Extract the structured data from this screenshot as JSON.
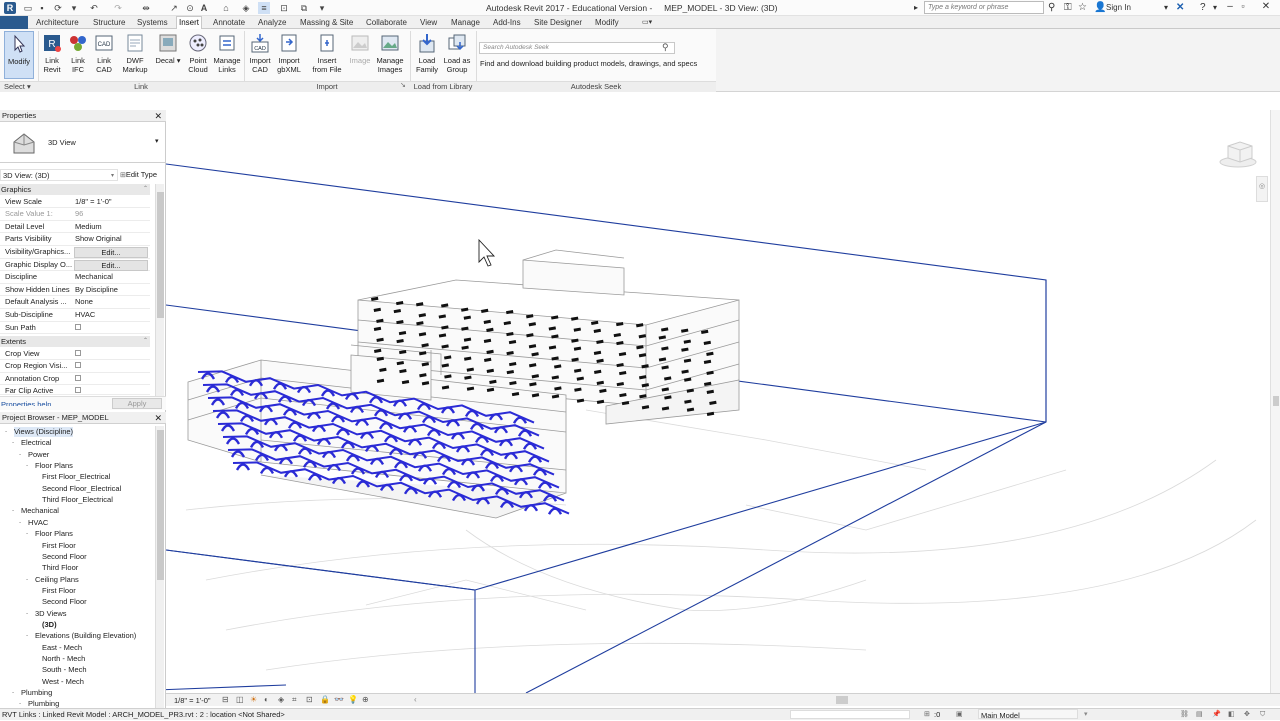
{
  "window": {
    "title": "Autodesk Revit 2017 - Educational Version -     MEP_MODEL - 3D View: (3D)",
    "search_placeholder": "Type a keyword or phrase",
    "sign_in": "Sign In"
  },
  "ribbon": {
    "tabs": [
      "Architecture",
      "Structure",
      "Systems",
      "Insert",
      "Annotate",
      "Analyze",
      "Massing & Site",
      "Collaborate",
      "View",
      "Manage",
      "Add-Ins",
      "Site Designer",
      "Modify"
    ],
    "active_tab": "Insert",
    "modify": {
      "label": "Modify"
    },
    "select_label": "Select",
    "link_panel": {
      "label": "Link",
      "buttons": [
        {
          "l1": "Link",
          "l2": "Revit"
        },
        {
          "l1": "Link",
          "l2": "IFC"
        },
        {
          "l1": "Link",
          "l2": "CAD"
        },
        {
          "l1": "DWF",
          "l2": "Markup"
        },
        {
          "l1": "Decal",
          "l2": ""
        },
        {
          "l1": "Point",
          "l2": "Cloud"
        },
        {
          "l1": "Manage",
          "l2": "Links"
        }
      ]
    },
    "import_panel": {
      "label": "Import",
      "buttons": [
        {
          "l1": "Import",
          "l2": "CAD"
        },
        {
          "l1": "Import",
          "l2": "gbXML"
        },
        {
          "l1": "Insert",
          "l2": "from File"
        },
        {
          "l1": "Image",
          "l2": ""
        },
        {
          "l1": "Manage",
          "l2": "Images"
        }
      ]
    },
    "library_panel": {
      "label": "Load from Library",
      "buttons": [
        {
          "l1": "Load",
          "l2": "Family"
        },
        {
          "l1": "Load as",
          "l2": "Group"
        }
      ]
    },
    "seek_panel": {
      "label": "Autodesk Seek",
      "placeholder": "Search Autodesk Seek",
      "description": "Find and download building product models, drawings, and specs"
    }
  },
  "properties": {
    "title": "Properties",
    "type_name": "3D View",
    "selector": "3D View: (3D)",
    "edit_type": "Edit Type",
    "categories": {
      "graphics": "Graphics",
      "extents": "Extents"
    },
    "rows": [
      {
        "k": "View Scale",
        "v": "1/8\" = 1'-0\""
      },
      {
        "k": "Scale Value    1:",
        "v": "96"
      },
      {
        "k": "Detail Level",
        "v": "Medium"
      },
      {
        "k": "Parts Visibility",
        "v": "Show Original"
      },
      {
        "k": "Visibility/Graphics...",
        "v": "Edit..."
      },
      {
        "k": "Graphic Display O...",
        "v": "Edit..."
      },
      {
        "k": "Discipline",
        "v": "Mechanical"
      },
      {
        "k": "Show Hidden Lines",
        "v": "By Discipline"
      },
      {
        "k": "Default Analysis ...",
        "v": "None"
      },
      {
        "k": "Sub-Discipline",
        "v": "HVAC"
      },
      {
        "k": "Sun Path",
        "v": ""
      }
    ],
    "extents_rows": [
      {
        "k": "Crop View"
      },
      {
        "k": "Crop Region Visi..."
      },
      {
        "k": "Annotation Crop"
      },
      {
        "k": "Far Clip Active"
      }
    ],
    "help_link": "Properties help",
    "apply": "Apply"
  },
  "browser": {
    "title": "Project Browser - MEP_MODEL",
    "nodes": [
      {
        "t": "Views (Discipline)",
        "d": 0,
        "tog": "-",
        "sel": true
      },
      {
        "t": "Electrical",
        "d": 1,
        "tog": "-"
      },
      {
        "t": "Power",
        "d": 2,
        "tog": "-"
      },
      {
        "t": "Floor Plans",
        "d": 3,
        "tog": "-"
      },
      {
        "t": "First Floor_Electrical",
        "d": 4
      },
      {
        "t": "Second Floor_Electrical",
        "d": 4
      },
      {
        "t": "Third Floor_Electrical",
        "d": 4
      },
      {
        "t": "Mechanical",
        "d": 1,
        "tog": "-"
      },
      {
        "t": "HVAC",
        "d": 2,
        "tog": "-"
      },
      {
        "t": "Floor Plans",
        "d": 3,
        "tog": "-"
      },
      {
        "t": "First Floor",
        "d": 4
      },
      {
        "t": "Second Floor",
        "d": 4
      },
      {
        "t": "Third Floor",
        "d": 4
      },
      {
        "t": "Ceiling Plans",
        "d": 3,
        "tog": "-"
      },
      {
        "t": "First Floor",
        "d": 4
      },
      {
        "t": "Second Floor",
        "d": 4
      },
      {
        "t": "3D Views",
        "d": 3,
        "tog": "-"
      },
      {
        "t": "(3D)",
        "d": 4,
        "bold": true
      },
      {
        "t": "Elevations (Building Elevation)",
        "d": 3,
        "tog": "-"
      },
      {
        "t": "East - Mech",
        "d": 4
      },
      {
        "t": "North - Mech",
        "d": 4
      },
      {
        "t": "South - Mech",
        "d": 4
      },
      {
        "t": "West - Mech",
        "d": 4
      },
      {
        "t": "Plumbing",
        "d": 1,
        "tog": "-"
      },
      {
        "t": "Plumbing",
        "d": 2,
        "tog": "-"
      }
    ]
  },
  "viewbar": {
    "scale": "1/8\" = 1'-0\""
  },
  "status": {
    "message": "RVT Links : Linked Revit Model : ARCH_MODEL_PR3.rvt : 2 : location <Not Shared>",
    "coord": ":0",
    "workset": "Main Model"
  },
  "colors": {
    "section_box": "#1f3d9e",
    "ductwork": "#2b2bd6",
    "ribbon_bg": "#fafafa",
    "file_tab": "#2a5a8e"
  },
  "icons": [
    "save-icon",
    "undo-icon",
    "redo-icon",
    "binoculars-icon",
    "star-icon",
    "user-icon",
    "help-icon",
    "viewcube-icon",
    "navigation-wheel-icon"
  ]
}
